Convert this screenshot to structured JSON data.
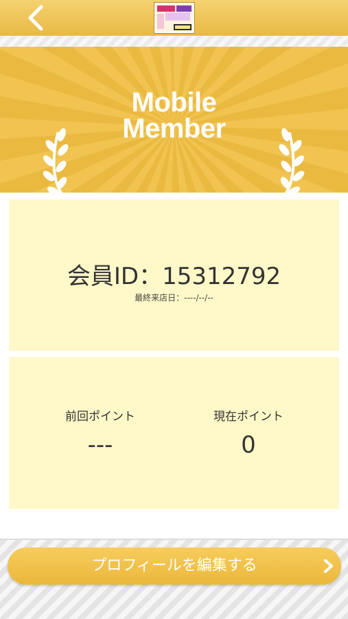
{
  "header": {
    "back_icon": "chevron-left-icon",
    "logo_alt": "store-logo"
  },
  "banner": {
    "title_line1": "Mobile",
    "title_line2": "Member",
    "decoration_icon": "laurel-icon"
  },
  "member": {
    "id_text": "会員ID：15312792",
    "last_visit": "最終来店日：----/--/--"
  },
  "points": {
    "previous_label": "前回ポイント",
    "previous_value": "---",
    "current_label": "現在ポイント",
    "current_value": "0"
  },
  "footer": {
    "edit_profile_label": "プロフィールを編集する",
    "edit_profile_icon": "chevron-right-icon"
  },
  "colors": {
    "accent": "#ecb93f",
    "card_bg": "#fff8c8",
    "text": "#333333"
  }
}
